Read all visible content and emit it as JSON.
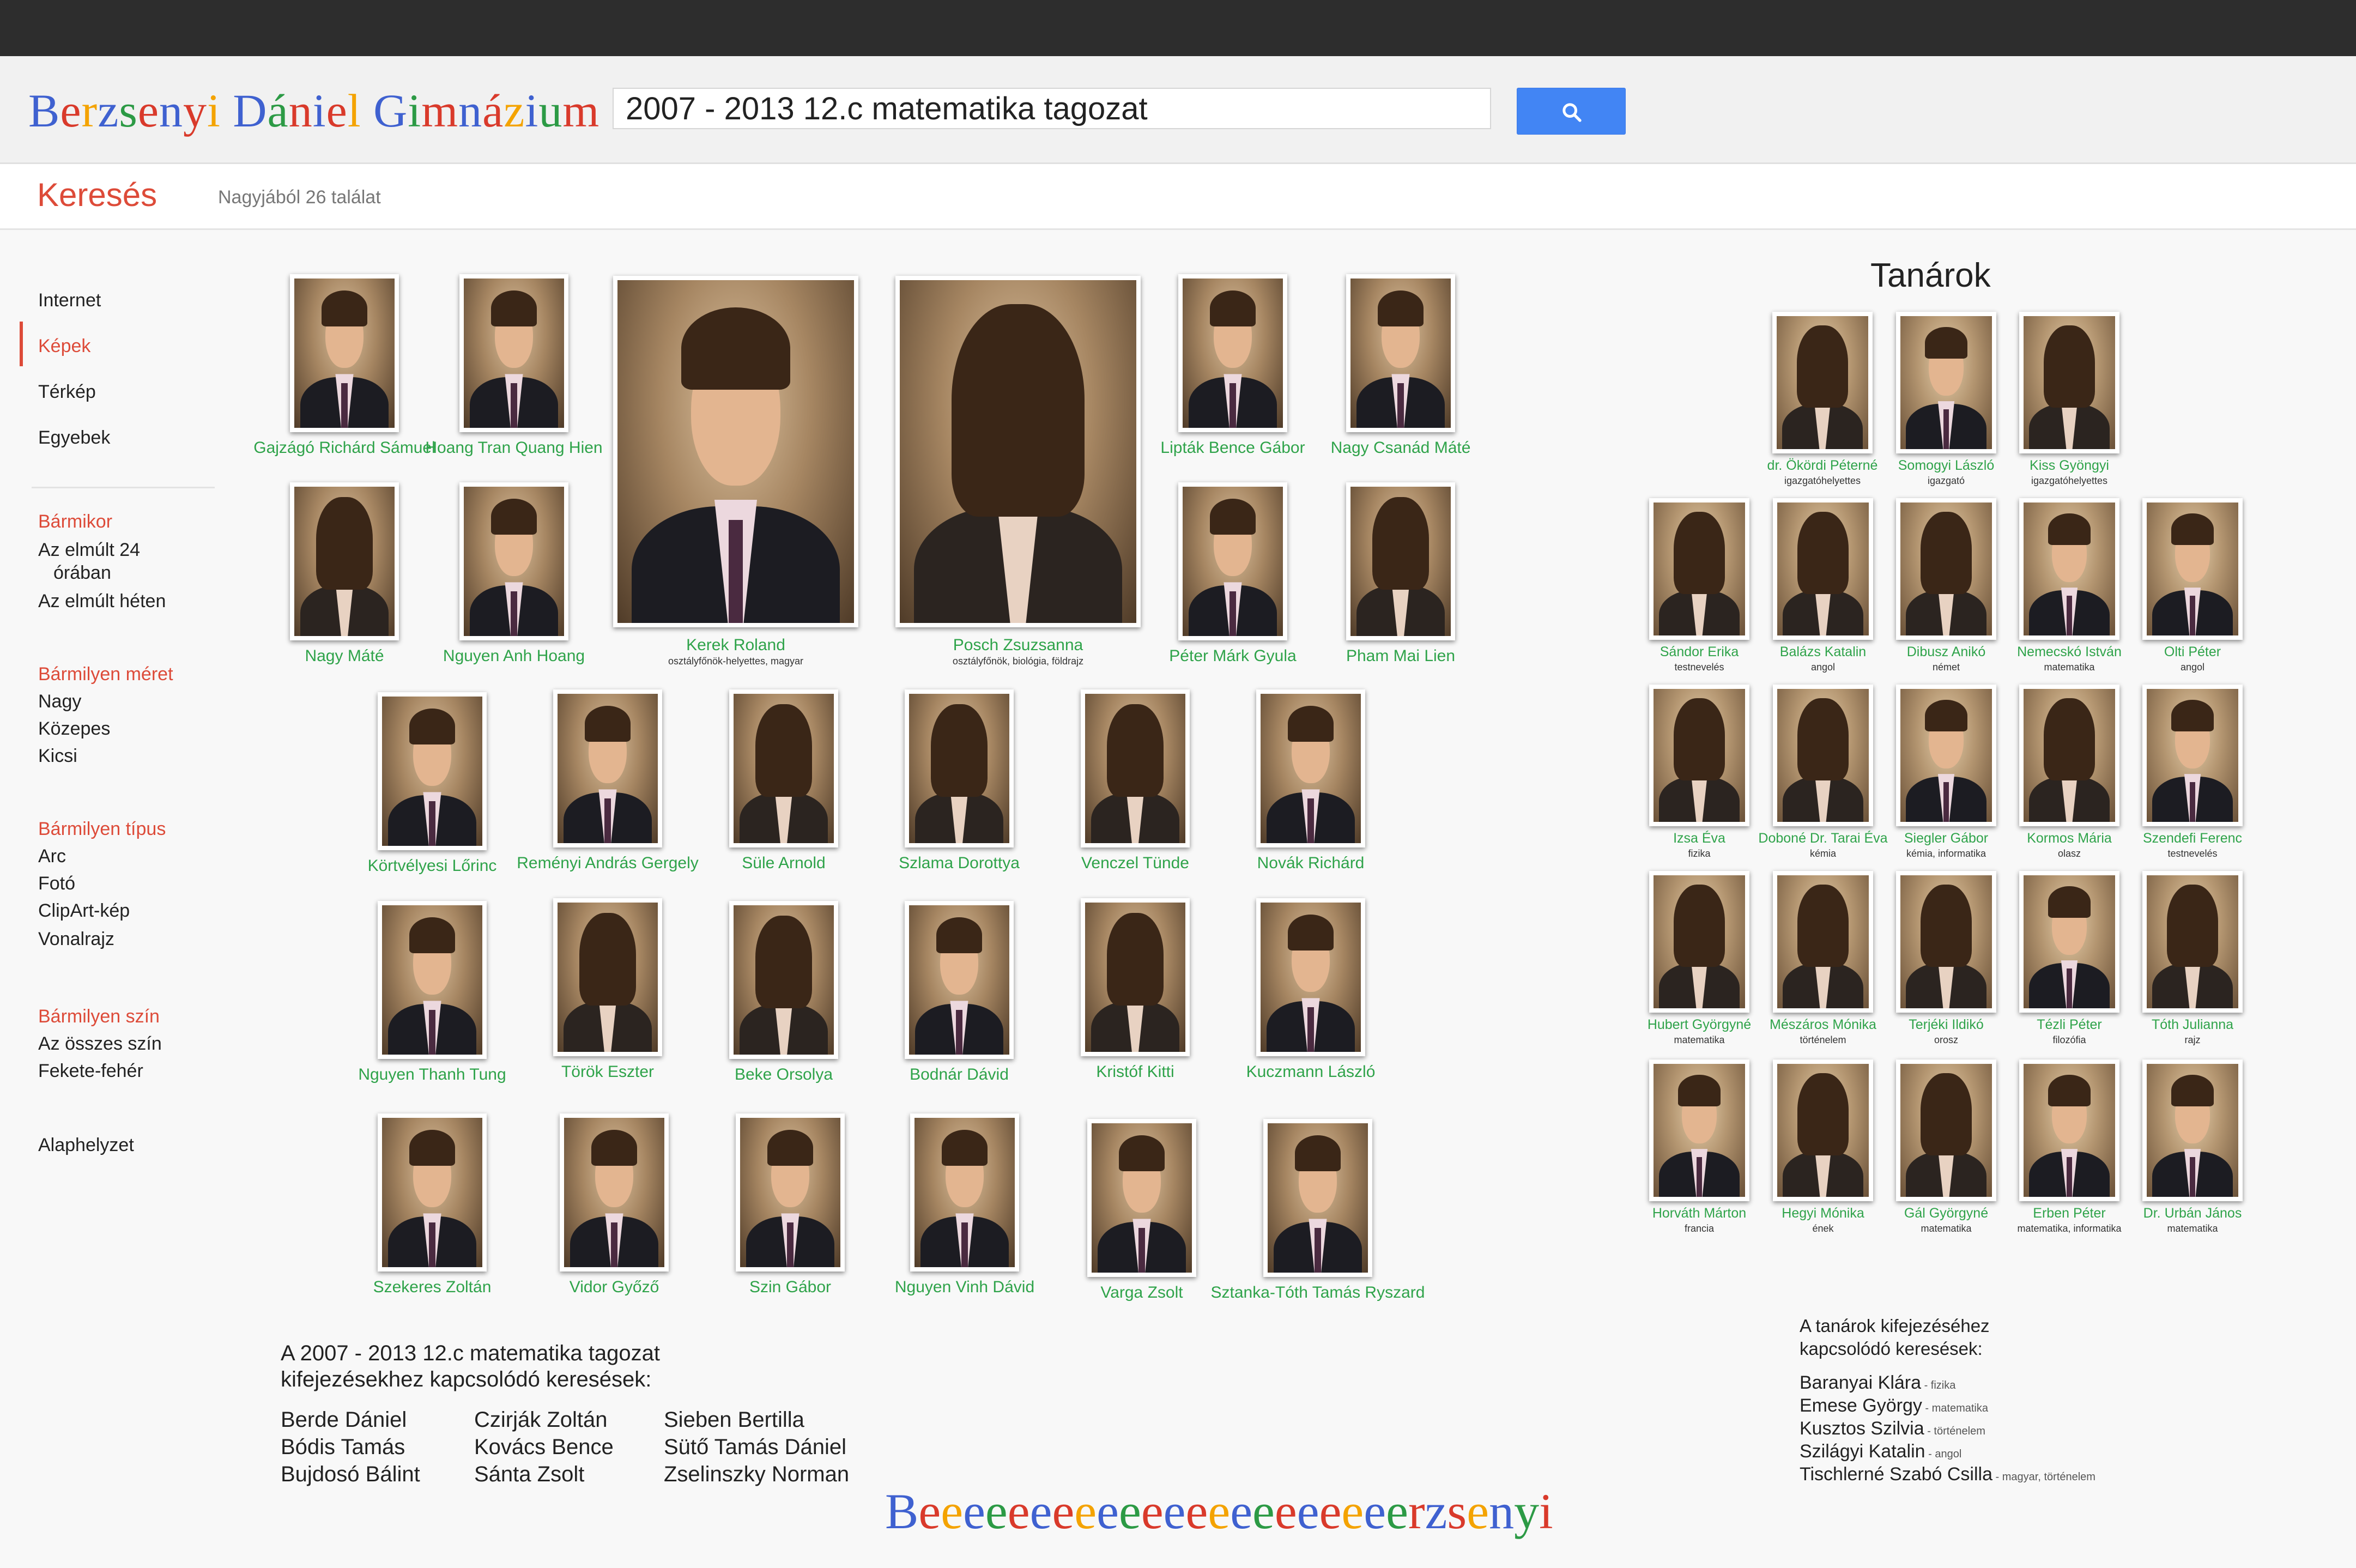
{
  "header": {
    "logo_text": "Berzsenyi Dániel Gimnázium",
    "search_value": "2007 - 2013 12.c matematika tagozat",
    "search_icon": "search-icon"
  },
  "subbar": {
    "title": "Keresés",
    "result_count": "Nagyjából 26 találat"
  },
  "nav": {
    "types": [
      "Internet",
      "Képek",
      "Térkép",
      "Egyebek"
    ],
    "time_head": "Bármikor",
    "time_items": [
      "Az elmúlt 24",
      "órában",
      "Az elmúlt héten"
    ],
    "size_head": "Bármilyen méret",
    "size_items": [
      "Nagy",
      "Közepes",
      "Kicsi"
    ],
    "type_head": "Bármilyen típus",
    "type_items": [
      "Arc",
      "Fotó",
      "ClipArt-kép",
      "Vonalrajz"
    ],
    "color_head": "Bármilyen szín",
    "color_items": [
      "Az összes szín",
      "Fekete-fehér"
    ],
    "reset": "Alaphelyzet"
  },
  "students": [
    "Gajzágó Richárd Sámuel",
    "Hoang Tran Quang Hien",
    "Lipták Bence Gábor",
    "Nagy Csanád Máté",
    "Nagy Máté",
    "Nguyen Anh Hoang",
    "Péter Márk Gyula",
    "Pham Mai Lien",
    "Körtvélyesi Lőrinc",
    "Reményi András Gergely",
    "Süle Arnold",
    "Szlama Dorottya",
    "Venczel Tünde",
    "Novák Richárd",
    "Nguyen Thanh Tung",
    "Török Eszter",
    "Beke Orsolya",
    "Bodnár Dávid",
    "Kristóf Kitti",
    "Kuczmann László",
    "Szekeres Zoltán",
    "Vidor Győző",
    "Szin Gábor",
    "Nguyen Vinh Dávid",
    "Varga Zsolt",
    "Sztanka-Tóth Tamás Ryszard"
  ],
  "class_teachers": [
    {
      "name": "Kerek Roland",
      "role": "osztályfőnök-helyettes, magyar"
    },
    {
      "name": "Posch Zsuzsanna",
      "role": "osztályfőnök, biológia, földrajz"
    }
  ],
  "teachers_title": "Tanárok",
  "teachers": [
    {
      "name": "dr. Ökördi Péterné",
      "role": "igazgatóhelyettes"
    },
    {
      "name": "Somogyi László",
      "role": "igazgató"
    },
    {
      "name": "Kiss Gyöngyi",
      "role": "igazgatóhelyettes"
    },
    {
      "name": "Sándor Erika",
      "role": "testnevelés"
    },
    {
      "name": "Balázs Katalin",
      "role": "angol"
    },
    {
      "name": "Dibusz Anikó",
      "role": "német"
    },
    {
      "name": "Nemecskó István",
      "role": "matematika"
    },
    {
      "name": "Olti Péter",
      "role": "angol"
    },
    {
      "name": "Izsa Éva",
      "role": "fizika"
    },
    {
      "name": "Doboné Dr. Tarai Éva",
      "role": "kémia"
    },
    {
      "name": "Siegler Gábor",
      "role": "kémia, informatika"
    },
    {
      "name": "Kormos Mária",
      "role": "olasz"
    },
    {
      "name": "Szendefi Ferenc",
      "role": "testnevelés"
    },
    {
      "name": "Hubert Györgyné",
      "role": "matematika"
    },
    {
      "name": "Mészáros Mónika",
      "role": "történelem"
    },
    {
      "name": "Terjéki Ildikó",
      "role": "orosz"
    },
    {
      "name": "Tézli Péter",
      "role": "filozófia"
    },
    {
      "name": "Tóth Julianna",
      "role": "rajz"
    },
    {
      "name": "Horváth Márton",
      "role": "francia"
    },
    {
      "name": "Hegyi Mónika",
      "role": "ének"
    },
    {
      "name": "Gál Györgyné",
      "role": "matematika"
    },
    {
      "name": "Erben Péter",
      "role": "matematika, informatika"
    },
    {
      "name": "Dr. Urbán János",
      "role": "matematika"
    }
  ],
  "related": {
    "head_line1": "A 2007 - 2013 12.c matematika tagozat",
    "head_line2": "kifejezésekhez kapcsolódó keresések:",
    "col1": [
      "Berde Dániel",
      "Bódis Tamás",
      "Bujdosó Bálint"
    ],
    "col2": [
      "Czirják Zoltán",
      "Kovács Bence",
      "Sánta Zsolt"
    ],
    "col3": [
      "Sieben Bertilla",
      "Sütő Tamás Dániel",
      "Zselinszky Norman"
    ]
  },
  "teacher_related": {
    "head_line1": "A tanárok kifejezéséhez",
    "head_line2": "kapcsolódó keresések:",
    "items": [
      {
        "name": "Baranyai Klára",
        "subj": " - fizika"
      },
      {
        "name": "Emese György",
        "subj": " - matematika"
      },
      {
        "name": "Kusztos Szilvia",
        "subj": " - történelem"
      },
      {
        "name": "Szilágyi Katalin",
        "subj": " - angol"
      },
      {
        "name": "Tischlerné Szabó Csilla",
        "subj": " - magyar, történelem"
      }
    ]
  },
  "bottom_logo": "Beeeeeeeeeeeeeeeeeeeeeerzsenyi",
  "logo_colors": [
    "#3f61d0",
    "#d93a2b",
    "#f4a300",
    "#3f61d0",
    "#2c9a45",
    "#d93a2b"
  ]
}
